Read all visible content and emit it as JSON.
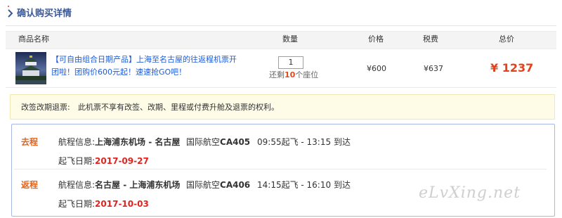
{
  "header": {
    "title": "确认购买详情"
  },
  "table": {
    "columns": [
      "商品名称",
      "数量",
      "价格",
      "税费",
      "总价"
    ],
    "row": {
      "product_text": "【可自由组合日期产品】上海至名古屋的往返程机票开团啦！团购价600元起！速速抢GO吧！",
      "quantity": "1",
      "remaining_prefix": "还剩",
      "remaining_count": "10",
      "remaining_suffix": "个座位",
      "price": "¥600",
      "tax": "¥637",
      "total": "¥ 1237"
    }
  },
  "notice": {
    "label": "改签改期退票:",
    "text": "此机票不享有改签、改期、里程或付费升舱及退票的权利。"
  },
  "legs": [
    {
      "label": "去程",
      "route_prefix": "航程信息:",
      "route": "上海浦东机场 - 名古屋",
      "airline_prefix": "国际航空",
      "flight": "CA405",
      "times": "09:55起飞 - 13:15 到达",
      "date_label": "起飞日期:",
      "date": "2017-09-27"
    },
    {
      "label": "返程",
      "route_prefix": "航程信息:",
      "route": "名古屋 - 上海浦东机场",
      "airline_prefix": "国际航空",
      "flight": "CA406",
      "times": "14:15起飞 - 16:10 到达",
      "date_label": "起飞日期:",
      "date": "2017-10-03"
    }
  ],
  "watermark": "eLvXing.net",
  "icons": {
    "header": "chevron-right-icon",
    "product": "castle-thumbnail-image"
  },
  "colors": {
    "accent": "#3b5998",
    "link": "#1f5bd6",
    "price_red": "#e6401a",
    "leg_orange": "#e06623",
    "date_red": "#e0231f"
  }
}
